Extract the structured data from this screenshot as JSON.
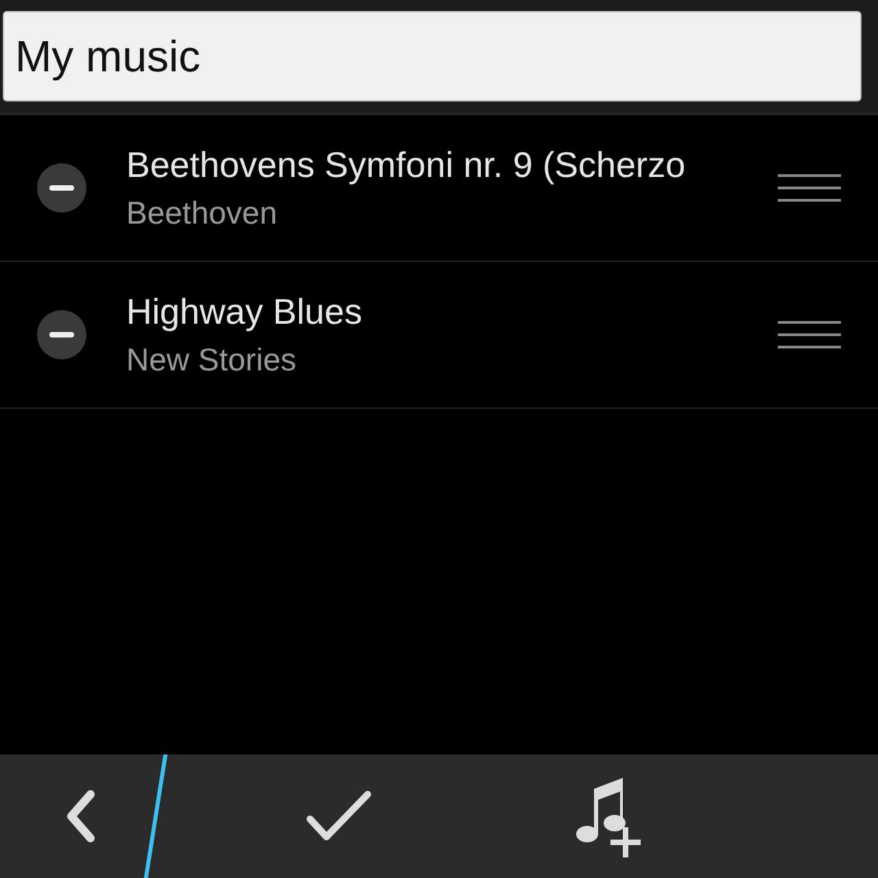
{
  "title_field": {
    "value": "My music"
  },
  "tracks": [
    {
      "title": "Beethovens Symfoni nr. 9 (Scherzo",
      "artist": "Beethoven"
    },
    {
      "title": "Highway Blues",
      "artist": "New Stories"
    }
  ],
  "action_bar": {
    "actions": [
      {
        "kind": "back"
      },
      {
        "kind": "confirm"
      },
      {
        "kind": "add-music"
      }
    ]
  }
}
